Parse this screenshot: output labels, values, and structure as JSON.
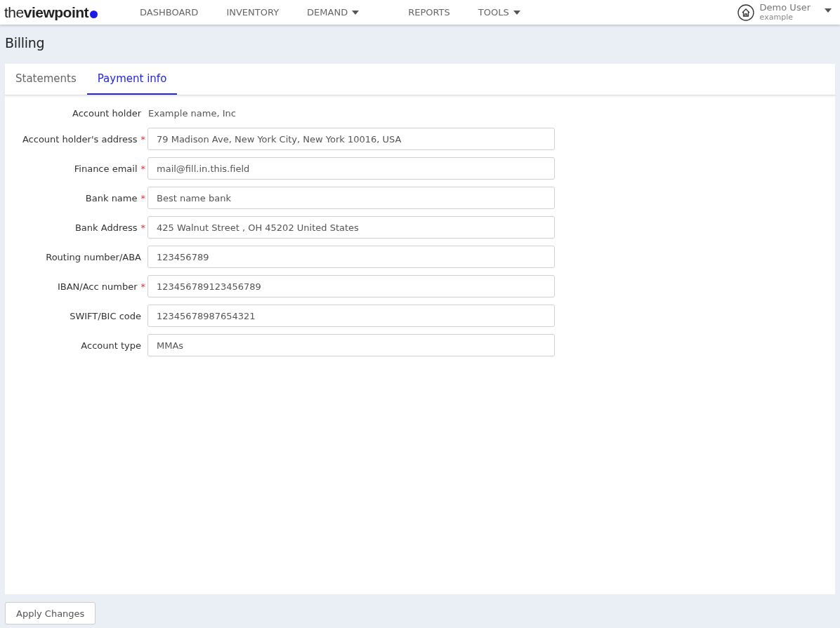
{
  "header": {
    "logo": "the**viewpoint**",
    "nav": [
      {
        "label": "DASHBOARD",
        "dropdown": false
      },
      {
        "label": "INVENTORY",
        "dropdown": false
      },
      {
        "label": "DEMAND",
        "dropdown": true
      },
      {
        "label": "REPORTS",
        "dropdown": false
      },
      {
        "label": "TOOLS",
        "dropdown": true
      }
    ],
    "user": {
      "name": "Demo User",
      "account": "example"
    }
  },
  "page_title": "Billing",
  "tabs": [
    {
      "label": "Statements",
      "selected": false
    },
    {
      "label": "Payment info",
      "selected": true
    }
  ],
  "fields": [
    {
      "kind": "text",
      "label": "Account holder",
      "value": "Example name, Inc"
    },
    {
      "kind": "input",
      "label": "Account holder's address",
      "required_mark": "*",
      "value": "79 Madison Ave, New York City, New York 10016, USA"
    },
    {
      "kind": "input",
      "label": "Finance email",
      "required_mark": "*",
      "value": "mail@fill.in.this.field"
    },
    {
      "kind": "input",
      "label": "Bank name",
      "required_mark": "*",
      "value": "Best name bank"
    },
    {
      "kind": "input",
      "label": "Bank Address",
      "required_mark": "*",
      "value": "425 Walnut Street , OH 45202 United States"
    },
    {
      "kind": "input",
      "label": "Routing number/ABA",
      "value": "123456789"
    },
    {
      "kind": "input",
      "label": "IBAN/Acc number",
      "required_mark": "*",
      "value": "123456789123456789"
    },
    {
      "kind": "input",
      "label": "SWIFT/BIC code",
      "value": "12345678987654321"
    },
    {
      "kind": "input",
      "label": "Account type",
      "value": "MMAs"
    }
  ],
  "apply_button": "Apply Changes"
}
